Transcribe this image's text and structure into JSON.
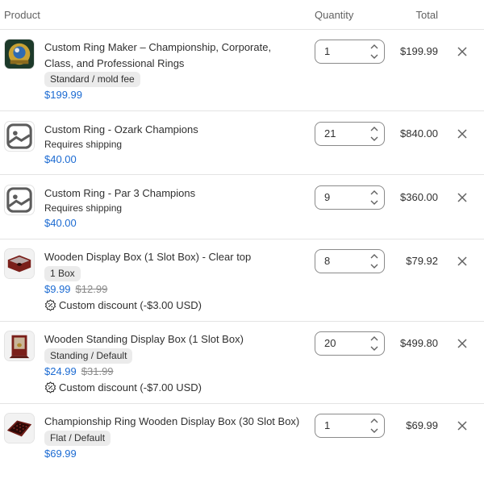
{
  "header": {
    "product": "Product",
    "quantity": "Quantity",
    "total": "Total"
  },
  "items": [
    {
      "title": "Custom Ring Maker – Championship, Corporate, Class, and Professional Rings",
      "variant": "Standard / mold fee",
      "price": "$199.99",
      "quantity": "1",
      "total": "$199.99",
      "image": "ring-photo"
    },
    {
      "title": "Custom Ring - Ozark Champions",
      "note": "Requires shipping",
      "price": "$40.00",
      "quantity": "21",
      "total": "$840.00",
      "image": "image-placeholder-icon"
    },
    {
      "title": "Custom Ring - Par 3 Champions",
      "note": "Requires shipping",
      "price": "$40.00",
      "quantity": "9",
      "total": "$360.00",
      "image": "image-placeholder-icon"
    },
    {
      "title": "Wooden Display Box (1 Slot Box) - Clear top",
      "variant": "1 Box",
      "price": "$9.99",
      "compare_price": "$12.99",
      "discount": "Custom discount (-$3.00 USD)",
      "quantity": "8",
      "total": "$79.92",
      "image": "display-box-photo"
    },
    {
      "title": "Wooden Standing Display Box (1 Slot Box)",
      "variant": "Standing / Default",
      "price": "$24.99",
      "compare_price": "$31.99",
      "discount": "Custom discount (-$7.00 USD)",
      "quantity": "20",
      "total": "$499.80",
      "image": "standing-box-photo"
    },
    {
      "title": "Championship Ring Wooden Display Box (30 Slot Box)",
      "variant": "Flat / Default",
      "price": "$69.99",
      "quantity": "1",
      "total": "$69.99",
      "image": "30-slot-box-photo"
    }
  ],
  "colors": {
    "price": "#1c6bd2",
    "border": "#e3e3e3",
    "badge": "#ebebeb"
  }
}
